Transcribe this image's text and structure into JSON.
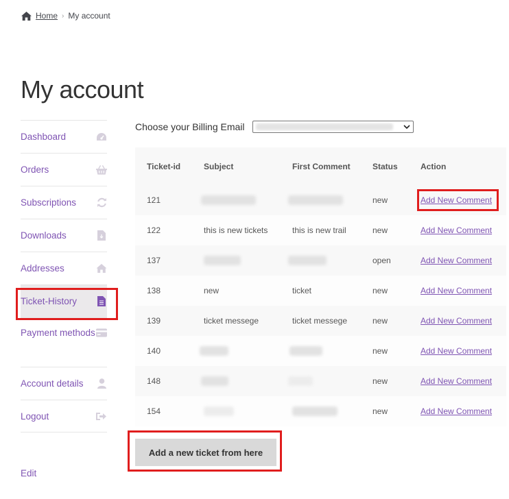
{
  "breadcrumb": {
    "home": "Home",
    "separator": "›",
    "current": "My account"
  },
  "page": {
    "title": "My account"
  },
  "sidebar": {
    "items": [
      {
        "label": "Dashboard",
        "icon": "dashboard-icon"
      },
      {
        "label": "Orders",
        "icon": "basket-icon"
      },
      {
        "label": "Subscriptions",
        "icon": "refresh-icon"
      },
      {
        "label": "Downloads",
        "icon": "file-download-icon"
      },
      {
        "label": "Addresses",
        "icon": "home-icon"
      },
      {
        "label": "Ticket-History",
        "icon": "file-text-icon",
        "active": true
      },
      {
        "label": "Payment methods",
        "icon": "credit-card-icon"
      },
      {
        "label": "Account details",
        "icon": "user-icon"
      },
      {
        "label": "Logout",
        "icon": "sign-out-icon"
      }
    ],
    "edit": "Edit"
  },
  "billing": {
    "label": "Choose your Billing Email",
    "value": ""
  },
  "table": {
    "headers": [
      "Ticket-id",
      "Subject",
      "First Comment",
      "Status",
      "Action"
    ],
    "rows": [
      {
        "id": "121",
        "subject": "",
        "comment": "",
        "status": "new",
        "action": "Add New Comment"
      },
      {
        "id": "122",
        "subject": "this is new tickets",
        "comment": "this is new trail",
        "status": "new",
        "action": "Add New Comment"
      },
      {
        "id": "137",
        "subject": "",
        "comment": "",
        "status": "open",
        "action": "Add New Comment"
      },
      {
        "id": "138",
        "subject": "new",
        "comment": "ticket",
        "status": "new",
        "action": "Add New Comment"
      },
      {
        "id": "139",
        "subject": "ticket messege",
        "comment": "ticket messege",
        "status": "new",
        "action": "Add New Comment"
      },
      {
        "id": "140",
        "subject": "",
        "comment": "",
        "status": "new",
        "action": "Add New Comment"
      },
      {
        "id": "148",
        "subject": "",
        "comment": "",
        "status": "new",
        "action": "Add New Comment"
      },
      {
        "id": "154",
        "subject": "",
        "comment": "",
        "status": "new",
        "action": "Add New Comment"
      }
    ]
  },
  "new_ticket_button": "Add a new ticket from here",
  "colors": {
    "link": "#7f54b3",
    "highlight": "#e01d1d",
    "icon": "#c9c4cf"
  }
}
